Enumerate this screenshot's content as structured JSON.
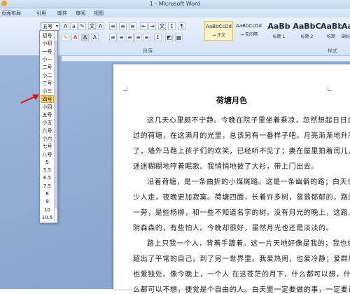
{
  "window": {
    "title": "1 - Microsoft Word"
  },
  "tabs": [
    "页面布局",
    "引用",
    "邮件",
    "审阅",
    "视图"
  ],
  "ribbon": {
    "font_size_value": "五号",
    "groups": {
      "paragraph": "段落",
      "styles": "样式"
    },
    "styles": [
      {
        "sample": "AaBbCcDd",
        "name": "→ 正文"
      },
      {
        "sample": "AaBbCcDd",
        "name": "→ 无间隔"
      },
      {
        "sample": "AaBb",
        "name": "标题 1"
      },
      {
        "sample": "AaBbC",
        "name": "标题 2"
      },
      {
        "sample": "AaBbC",
        "name": "标题"
      },
      {
        "sample": "AaBbC",
        "name": "副标题"
      }
    ]
  },
  "font_size_options": [
    "初号",
    "小初",
    "一号",
    "小一",
    "二号",
    "小二",
    "三号",
    "小三",
    "四号",
    "小四",
    "五号",
    "小五",
    "六号",
    "小六",
    "七号",
    "八号",
    "5",
    "5.5",
    "6.5",
    "7.5",
    "8",
    "9",
    "10",
    "10.5"
  ],
  "document": {
    "title": "荷塘月色",
    "lines": [
      "这几天心里颇不宁静。今晚在院子里坐着乘凉，忽然想起日日走",
      "过的荷塘，在这满月的光里，总该另有一番样子吧。月亮渐渐地升高",
      "了，墙外马路上孩子们的欢笑，已经听不见了；妻在屋里拍着闰儿，",
      "迷迷糊糊地哼着眠歌。我悄悄地披了大衫，带上门出去。",
      "沿着荷塘，是一条曲折的小煤屑路。这是一条幽僻的路；白天也",
      "少人走，夜晚更加寂寞。荷塘四面，长着许多树，蓊蓊郁郁的。路的",
      "一旁，是些杨柳，和一些不知道名字的树。没有月光的晚上，这路上",
      "阴森森的，有些怕人。今晚却很好，虽然月光也还是淡淡的。",
      "路上只我一个人，背着手踱着。这一片天地好像是我的；我也像",
      "超出了平常的自己，到了另一世界里。我爱热闹，也爱冷静；爱群居，",
      "也爱独处。像今晚上，一个人 在这苍茫的月下，什么都可以想，什",
      "么都可以不想，便觉是个自由的人。白天里一定要做的事，一定要说"
    ]
  }
}
